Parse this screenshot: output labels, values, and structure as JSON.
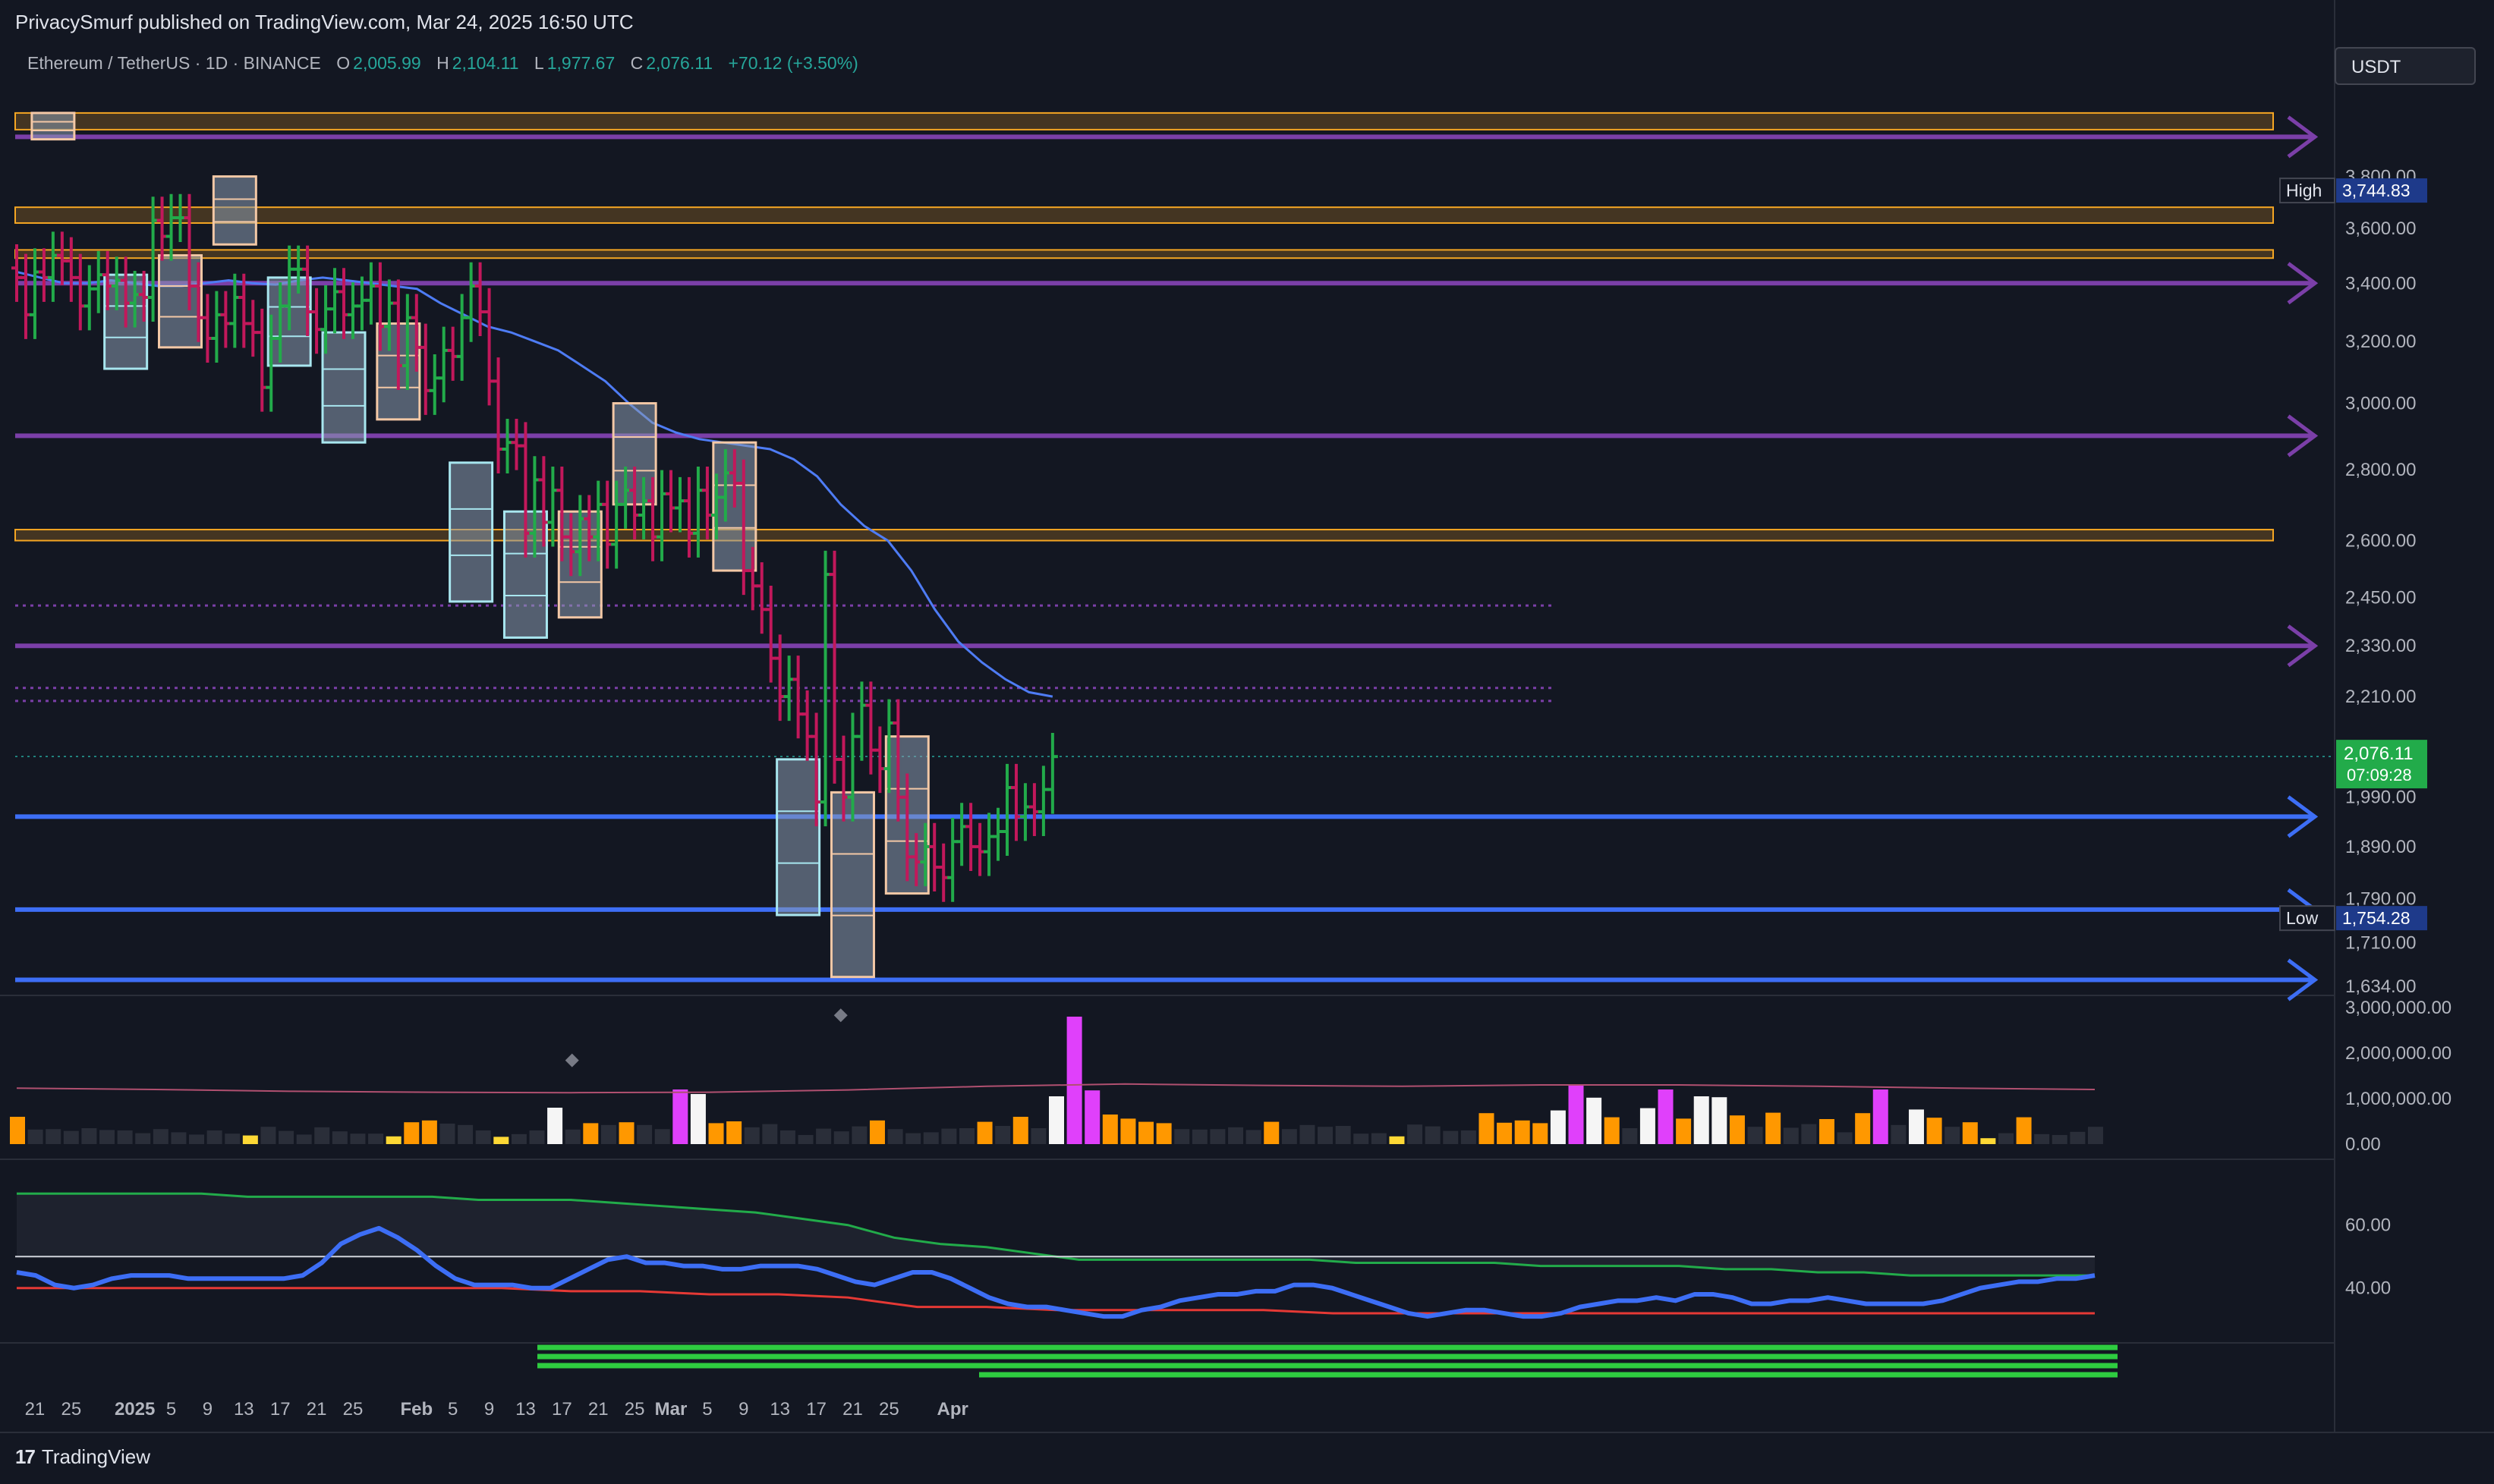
{
  "header": {
    "published": "PrivacySmurf published on TradingView.com, Mar 24, 2025 16:50 UTC"
  },
  "legend": {
    "symbol": "Ethereum / TetherUS · 1D · BINANCE",
    "o_label": "O",
    "o": "2,005.99",
    "h_label": "H",
    "h": "2,104.11",
    "l_label": "L",
    "l": "1,977.67",
    "c_label": "C",
    "c": "2,076.11",
    "change": "+70.12 (+3.50%)"
  },
  "currency": "USDT",
  "footer": {
    "brand": "TradingView",
    "logo": "17"
  },
  "colors": {
    "background": "#131722",
    "up": "#26a69a",
    "candle_up": "#22ab4a",
    "candle_down": "#c2185b",
    "ma": "#4e7cf5",
    "purple_level": "#7b3fa8",
    "orange_zone": "#f5a623",
    "blue_level": "#3d6ef5",
    "rsi": "#3d6ef5",
    "text": "#b2b5be"
  },
  "chart_data": [
    {
      "type": "candlestick",
      "price_axis_ticks": [
        "3,800.00",
        "3,600.00",
        "3,400.00",
        "3,200.00",
        "3,000.00",
        "2,800.00",
        "2,600.00",
        "2,450.00",
        "2,330.00",
        "2,210.00",
        "1,990.00",
        "1,890.00",
        "1,790.00",
        "1,710.00",
        "1,634.00"
      ],
      "price_tick_values": [
        3800,
        3600,
        3400,
        3200,
        3000,
        2800,
        2600,
        2450,
        2330,
        2210,
        1990,
        1890,
        1790,
        1710,
        1634
      ],
      "scale": "log",
      "ylim": [
        1634,
        4050
      ],
      "x_axis_labels": [
        "21",
        "25",
        "2025",
        "5",
        "9",
        "13",
        "17",
        "21",
        "25",
        "Feb",
        "5",
        "9",
        "13",
        "17",
        "21",
        "25",
        "Mar",
        "5",
        "9",
        "13",
        "17",
        "21",
        "25",
        "Apr"
      ],
      "x_label_dates": [
        "2024-12-21",
        "2024-12-25",
        "2025-01-01",
        "2025-01-05",
        "2025-01-09",
        "2025-01-13",
        "2025-01-17",
        "2025-01-21",
        "2025-01-25",
        "2025-02-01",
        "2025-02-05",
        "2025-02-09",
        "2025-02-13",
        "2025-02-17",
        "2025-02-21",
        "2025-02-25",
        "2025-03-01",
        "2025-03-05",
        "2025-03-09",
        "2025-03-13",
        "2025-03-17",
        "2025-03-21",
        "2025-03-25",
        "2025-04-01"
      ],
      "start_date": "2024-12-19",
      "daily_close": [
        3420,
        3290,
        3440,
        3420,
        3500,
        3480,
        3420,
        3320,
        3380,
        3430,
        3390,
        3410,
        3330,
        3360,
        3350,
        3630,
        3570,
        3640,
        3640,
        3390,
        3280,
        3210,
        3290,
        3260,
        3350,
        3260,
        3230,
        3050,
        3210,
        3320,
        3450,
        3450,
        3300,
        3240,
        3310,
        3370,
        3290,
        3320,
        3340,
        3390,
        3250,
        3330,
        3120,
        3280,
        3180,
        3040,
        3080,
        3170,
        3150,
        3280,
        3390,
        3300,
        3070,
        2860,
        2880,
        2870,
        2620,
        2770,
        2650,
        2740,
        2610,
        2570,
        2660,
        2610,
        2700,
        2590,
        2700,
        2740,
        2670,
        2710,
        2610,
        2730,
        2690,
        2710,
        2620,
        2740,
        2670,
        2720,
        2790,
        2760,
        2520,
        2480,
        2420,
        2300,
        2210,
        2250,
        2170,
        2120,
        1980,
        2510,
        2070,
        1990,
        2120,
        2190,
        2090,
        2050,
        2150,
        1990,
        1870,
        1860,
        1890,
        1850,
        1830,
        1900,
        1930,
        1890,
        1880,
        1910,
        1920,
        2010,
        1950,
        1970,
        1960,
        2006,
        2076
      ],
      "high": {
        "label": "High",
        "value": "3,744.83"
      },
      "low": {
        "label": "Low",
        "value": "1,754.28"
      },
      "last": {
        "value": "2,076.11",
        "countdown": "07:09:28"
      },
      "ma_values": [
        3440,
        3420,
        3400,
        3400,
        3410,
        3400,
        3390,
        3390,
        3400,
        3410,
        3400,
        3395,
        3410,
        3420,
        3410,
        3400,
        3390,
        3380,
        3330,
        3290,
        3250,
        3230,
        3200,
        3170,
        3120,
        3070,
        3000,
        2940,
        2910,
        2890,
        2880,
        2870,
        2860,
        2830,
        2780,
        2700,
        2640,
        2600,
        2520,
        2420,
        2340,
        2290,
        2250,
        2220,
        2210
      ],
      "purple_levels": [
        3960,
        3400,
        2900,
        2330
      ],
      "purple_dotted_levels": [
        2430,
        2230,
        2200
      ],
      "orange_zones": [
        [
          3990,
          4060
        ],
        [
          3620,
          3680
        ],
        [
          3490,
          3520
        ],
        [
          2600,
          2630
        ]
      ],
      "blue_levels": [
        1950,
        1770,
        1645
      ],
      "marker_boxes": [
        {
          "date": "2024-12-23",
          "top": 4060,
          "bottom": 3950,
          "edge": "orange"
        },
        {
          "date": "2024-12-31",
          "top": 3430,
          "bottom": 3110,
          "edge": "cyan"
        },
        {
          "date": "2025-01-06",
          "top": 3500,
          "bottom": 3180,
          "edge": "orange"
        },
        {
          "date": "2025-01-12",
          "top": 3800,
          "bottom": 3540,
          "edge": "orange"
        },
        {
          "date": "2025-01-18",
          "top": 3420,
          "bottom": 3120,
          "edge": "cyan"
        },
        {
          "date": "2025-01-24",
          "top": 3230,
          "bottom": 2880,
          "edge": "cyan"
        },
        {
          "date": "2025-01-30",
          "top": 3260,
          "bottom": 2950,
          "edge": "orange"
        },
        {
          "date": "2025-02-07",
          "top": 2820,
          "bottom": 2440,
          "edge": "cyan"
        },
        {
          "date": "2025-02-13",
          "top": 2680,
          "bottom": 2350,
          "edge": "cyan"
        },
        {
          "date": "2025-02-19",
          "top": 2680,
          "bottom": 2400,
          "edge": "orange"
        },
        {
          "date": "2025-02-25",
          "top": 3000,
          "bottom": 2700,
          "edge": "orange"
        },
        {
          "date": "2025-03-08",
          "top": 2880,
          "bottom": 2520,
          "edge": "orange"
        },
        {
          "date": "2025-03-15",
          "top": 2070,
          "bottom": 1760,
          "edge": "cyan"
        },
        {
          "date": "2025-03-21",
          "top": 2000,
          "bottom": 1650,
          "edge": "orange"
        },
        {
          "date": "2025-03-27",
          "top": 2120,
          "bottom": 1800,
          "edge": "orange"
        }
      ]
    },
    {
      "type": "bar",
      "axis_ticks": [
        "3,000,000.00",
        "2,000,000.00",
        "1,000,000.00",
        "0.00"
      ],
      "tick_values": [
        3000000,
        2000000,
        1000000,
        0
      ],
      "ylim": [
        0,
        3100000
      ],
      "start_date": "2024-12-19",
      "values": [
        600000,
        320000,
        330000,
        290000,
        350000,
        310000,
        300000,
        240000,
        330000,
        260000,
        210000,
        300000,
        230000,
        190000,
        380000,
        290000,
        210000,
        370000,
        280000,
        230000,
        230000,
        170000,
        480000,
        520000,
        450000,
        420000,
        300000,
        160000,
        220000,
        300000,
        800000,
        320000,
        460000,
        420000,
        480000,
        420000,
        330000,
        1200000,
        1100000,
        460000,
        500000,
        370000,
        440000,
        300000,
        200000,
        340000,
        280000,
        390000,
        520000,
        330000,
        240000,
        260000,
        340000,
        350000,
        490000,
        400000,
        600000,
        350000,
        1050000,
        2800000,
        1180000,
        650000,
        560000,
        490000,
        460000,
        330000,
        320000,
        330000,
        370000,
        310000,
        490000,
        330000,
        420000,
        380000,
        400000,
        230000,
        240000,
        170000,
        430000,
        390000,
        290000,
        300000,
        680000,
        470000,
        520000,
        460000,
        740000,
        1300000,
        1020000,
        590000,
        350000,
        790000,
        1200000,
        560000,
        1050000,
        1030000,
        630000,
        380000,
        690000,
        360000,
        440000,
        550000,
        260000,
        680000,
        1200000,
        420000,
        760000,
        580000,
        380000,
        480000,
        130000,
        240000,
        590000,
        220000,
        200000,
        270000,
        380000
      ],
      "colors_by_index_note": "",
      "ma_values": [
        1230000,
        1200000,
        1160000,
        1140000,
        1130000,
        1140000,
        1190000,
        1270000,
        1320000,
        1290000,
        1270000,
        1300000,
        1300000,
        1270000,
        1230000,
        1200000
      ],
      "markers": [
        {
          "date": "2025-01-19",
          "value": 1840000
        },
        {
          "date": "2025-02-03",
          "value": 2830000
        }
      ]
    },
    {
      "type": "line",
      "axis_ticks": [
        "60.00",
        "40.00"
      ],
      "tick_values": [
        60,
        40
      ],
      "ylim": [
        25,
        78
      ],
      "start_date": "2024-12-19",
      "rsi": [
        45,
        44,
        41,
        40,
        41,
        43,
        44,
        44,
        44,
        43,
        43,
        43,
        43,
        43,
        43,
        44,
        48,
        54,
        57,
        59,
        56,
        52,
        47,
        43,
        41,
        41,
        41,
        40,
        40,
        43,
        46,
        49,
        50,
        48,
        48,
        47,
        47,
        46,
        46,
        47,
        47,
        47,
        46,
        44,
        42,
        41,
        43,
        45,
        45,
        43,
        40,
        37,
        35,
        34,
        34,
        33,
        32,
        31,
        31,
        33,
        34,
        36,
        37,
        38,
        38,
        39,
        39,
        41,
        41,
        40,
        38,
        36,
        34,
        32,
        31,
        32,
        33,
        33,
        32,
        31,
        31,
        32,
        34,
        35,
        36,
        36,
        37,
        36,
        38,
        38,
        37,
        35,
        35,
        36,
        36,
        37,
        36,
        35,
        35,
        35,
        35,
        36,
        38,
        40,
        41,
        42,
        42,
        43,
        43,
        44
      ],
      "upper_band": [
        70,
        70,
        70,
        70,
        70,
        69,
        69,
        69,
        69,
        69,
        68,
        68,
        68,
        67,
        66,
        65,
        64,
        62,
        60,
        56,
        54,
        53,
        51,
        49,
        49,
        49,
        49,
        49,
        49,
        48,
        48,
        48,
        48,
        47,
        47,
        47,
        47,
        46,
        46,
        45,
        45,
        44,
        44,
        44,
        44,
        44
      ],
      "lower_band": [
        40,
        40,
        40,
        40,
        40,
        40,
        40,
        40,
        39,
        39,
        38,
        38,
        37,
        34,
        34,
        33,
        33,
        33,
        33,
        32,
        32,
        32,
        32,
        32,
        32,
        32,
        32,
        32,
        32,
        32,
        32
      ],
      "hline": 50,
      "timeframe_bars": 4
    }
  ]
}
